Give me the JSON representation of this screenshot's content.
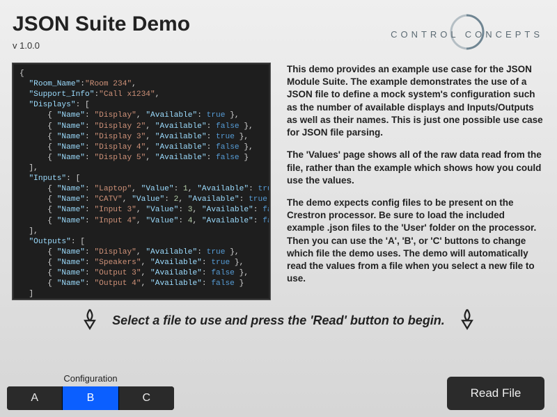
{
  "header": {
    "title": "JSON Suite Demo",
    "version": "v 1.0.0",
    "logo_text": "CONTROL CONCEPTS"
  },
  "code_sample": {
    "Room_Name": "Room 234",
    "Support_Info": "Call x1234",
    "Displays": [
      {
        "Name": "Display",
        "Available": true
      },
      {
        "Name": "Display 2",
        "Available": false
      },
      {
        "Name": "Display 3",
        "Available": true
      },
      {
        "Name": "Display 4",
        "Available": false
      },
      {
        "Name": "Display 5",
        "Available": false
      }
    ],
    "Inputs": [
      {
        "Name": "Laptop",
        "Value": 1,
        "Available": true
      },
      {
        "Name": "CATV",
        "Value": 2,
        "Available": true
      },
      {
        "Name": "Input 3",
        "Value": 3,
        "Available": false
      },
      {
        "Name": "Input 4",
        "Value": 4,
        "Available": false
      }
    ],
    "Outputs": [
      {
        "Name": "Display",
        "Available": true
      },
      {
        "Name": "Speakers",
        "Available": true
      },
      {
        "Name": "Output 3",
        "Available": false
      },
      {
        "Name": "Output 4",
        "Available": false
      }
    ]
  },
  "description": {
    "p1": "This demo provides an example use case for the JSON Module Suite. The example demonstrates the use of a JSON file to define a mock system's configuration such as the number of available displays and Inputs/Outputs as well as their names. This is just one possible use case for JSON file parsing.",
    "p2": "The 'Values' page shows all of the raw data read from the file, rather than the example which shows how you could use the values.",
    "p3": "The demo expects config files to be present on the Crestron processor. Be sure to load the included example .json files to the 'User' folder on the processor. Then you can use the 'A', 'B', or 'C' buttons to change which file the demo uses. The demo will automatically read the values from a file when you select a new file to use."
  },
  "prompt": "Select a file to use and press the 'Read' button to begin.",
  "config": {
    "label": "Configuration",
    "options": [
      "A",
      "B",
      "C"
    ],
    "selected": "B"
  },
  "read_button": "Read File"
}
